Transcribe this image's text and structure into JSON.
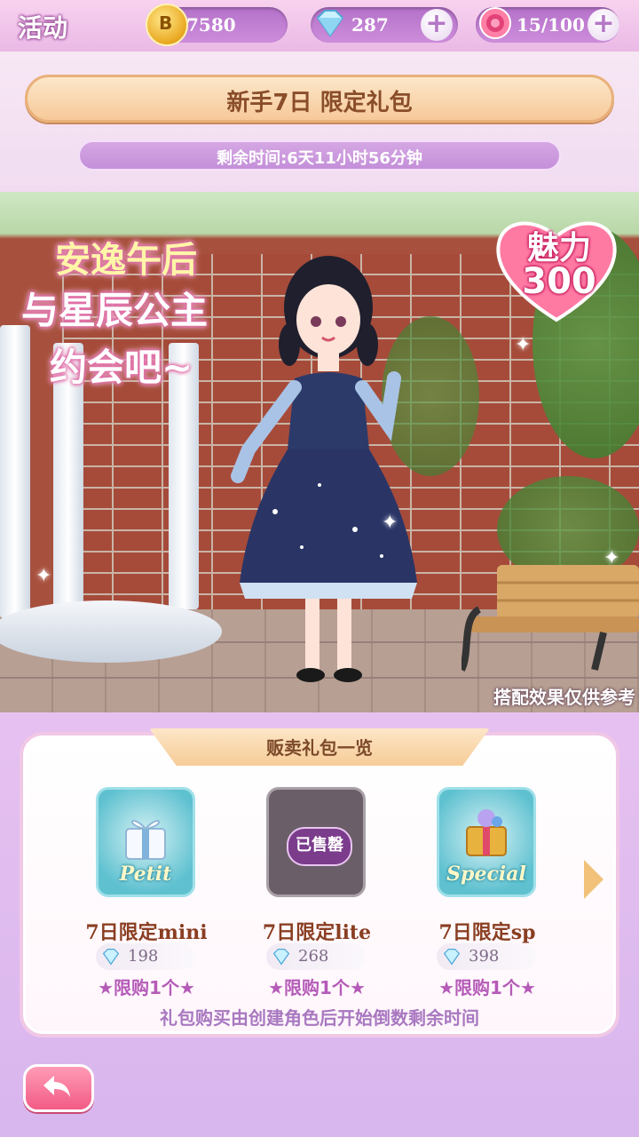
{
  "topbar": {
    "title": "活动",
    "coins": "7580",
    "gems": "287",
    "stamina": "15/100",
    "coin_symbol": "B",
    "icons": [
      "coin-icon",
      "diamond-icon",
      "rose-icon",
      "plus-icon"
    ]
  },
  "header": {
    "banner_title": "新手7日 限定礼包",
    "timer": "剩余时间:6天11小时56分钟"
  },
  "scene": {
    "slogan_line1": "安逸午后",
    "slogan_line2": "与星辰公主",
    "slogan_line3": "约会吧~",
    "charm_label": "魅力",
    "charm_value": "300",
    "disclaimer": "搭配效果仅供参考"
  },
  "shop": {
    "section_title": "贩卖礼包一览",
    "items": [
      {
        "label": "7日限定mini",
        "price": "198",
        "limit": "★限购1个★",
        "badge_word": "Petit",
        "sold_out": false
      },
      {
        "label": "7日限定lite",
        "price": "268",
        "limit": "★限购1个★",
        "badge_word": "",
        "sold_out": true,
        "sold_text": "已售罄"
      },
      {
        "label": "7日限定sp",
        "price": "398",
        "limit": "★限购1个★",
        "badge_word": "Special",
        "sold_out": false
      }
    ],
    "note": "礼包购买由创建角色后开始倒数剩余时间"
  },
  "colors": {
    "accent_pink": "#f25b85",
    "purple": "#b471c9",
    "brown_text": "#8a3e22",
    "limit_text": "#b55bb8"
  }
}
